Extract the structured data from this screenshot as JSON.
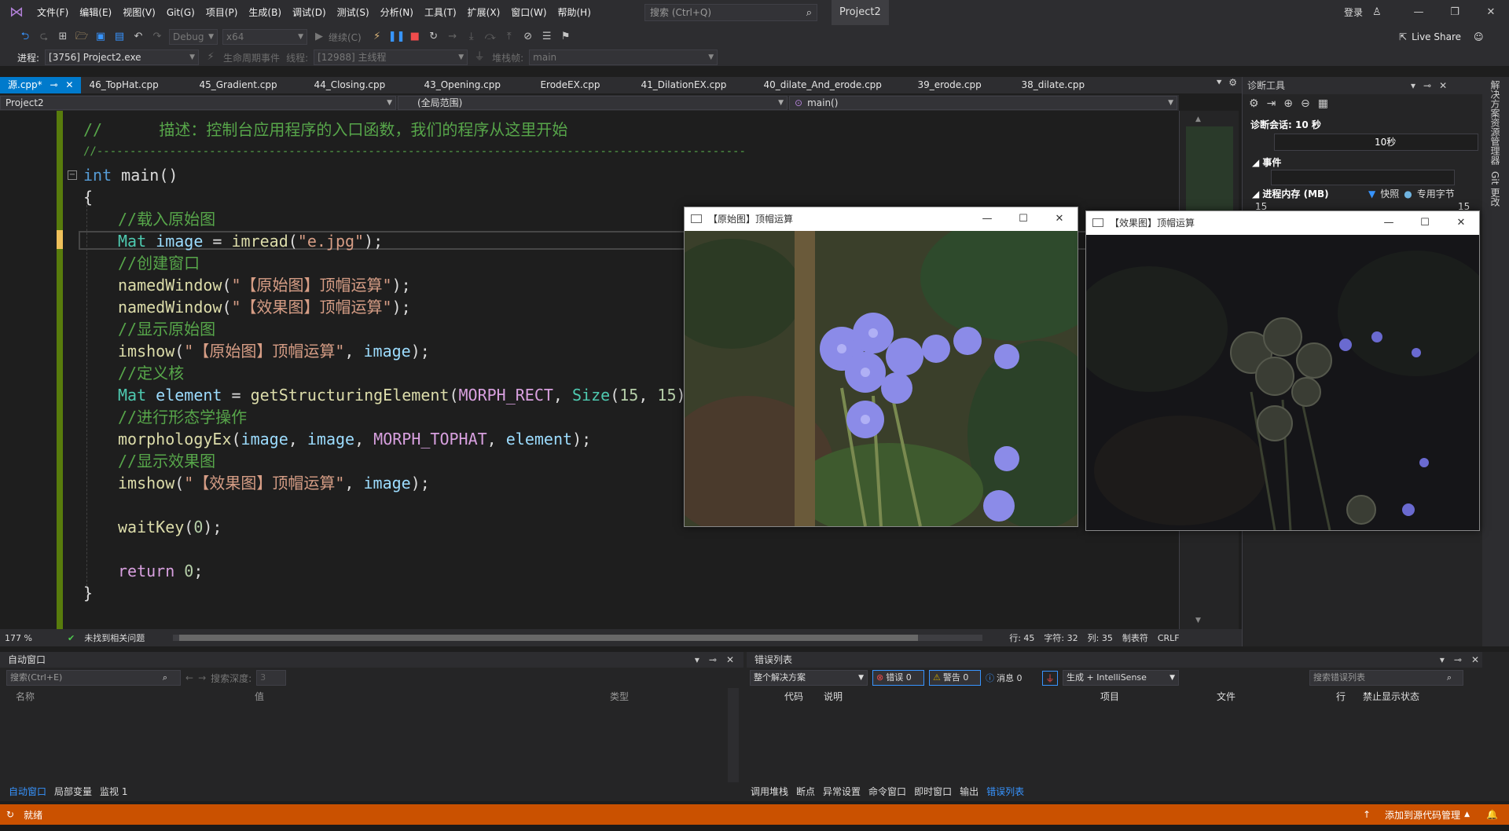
{
  "titlebar": {
    "menu": [
      "文件(F)",
      "编辑(E)",
      "视图(V)",
      "Git(G)",
      "项目(P)",
      "生成(B)",
      "调试(D)",
      "测试(S)",
      "分析(N)",
      "工具(T)",
      "扩展(X)",
      "窗口(W)",
      "帮助(H)"
    ],
    "search_placeholder": "搜索 (Ctrl+Q)",
    "project_name": "Project2",
    "signin": "登录"
  },
  "toolbar": {
    "config": "Debug",
    "platform": "x64",
    "continue": "继续(C)",
    "liveshare": "Live Share"
  },
  "toolbar2": {
    "process_label": "进程:",
    "process_value": "[3756] Project2.exe",
    "lifecycle": "生命周期事件",
    "thread_label": "线程:",
    "thread_value": "[12988] 主线程",
    "stack_label": "堆栈帧:",
    "stack_value": "main"
  },
  "tabs": [
    "源.cpp*",
    "46_TopHat.cpp",
    "45_Gradient.cpp",
    "44_Closing.cpp",
    "43_Opening.cpp",
    "ErodeEX.cpp",
    "41_DilationEX.cpp",
    "40_dilate_And_erode.cpp",
    "39_erode.cpp",
    "38_dilate.cpp"
  ],
  "navbar": {
    "project": "Project2",
    "scope": "(全局范围)",
    "function": "main()"
  },
  "code": {
    "l1": "//      描述：控制台应用程序的入口函数，我们的程序从这里开始",
    "l2": "//--------------------------------------------------------------------------------------------------",
    "l3_kw": "int",
    "l3_rest": " main()",
    "l4": "{",
    "l5": "//载入原始图",
    "l6_ty": "Mat",
    "l6_var": " image",
    "l6_eq": " = ",
    "l6_fn": "imread",
    "l6_open": "(",
    "l6_str": "\"e.jpg\"",
    "l6_close": ");",
    "l7": "//创建窗口",
    "l8_fn": "namedWindow",
    "l8_str": "\"【原始图】顶帽运算\"",
    "l9_fn": "namedWindow",
    "l9_str": "\"【效果图】顶帽运算\"",
    "l10": "//显示原始图",
    "l11_fn": "imshow",
    "l11_str": "\"【原始图】顶帽运算\"",
    "l11_var": "image",
    "l12": "//定义核",
    "l13_ty": "Mat",
    "l13_var": " element",
    "l13_fn": "getStructuringElement",
    "l13_mac": "MORPH_RECT",
    "l13_ty2": "Size",
    "l13_n1": "15",
    "l13_n2": "15",
    "l14": "//进行形态学操作",
    "l15_fn": "morphologyEx",
    "l15_args": "image",
    "l15_args2": "image",
    "l15_mac": "MORPH_TOPHAT",
    "l15_args3": "element",
    "l16": "//显示效果图",
    "l17_fn": "imshow",
    "l17_str": "\"【效果图】顶帽运算\"",
    "l17_var": "image",
    "l18_fn": "waitKey",
    "l18_n": "0",
    "l19_kw": "return",
    "l19_n": "0",
    "l20": "}"
  },
  "editor_status": {
    "zoom": "177 %",
    "issues": "未找到相关问题",
    "line": "行: 45",
    "char": "字符: 32",
    "col": "列: 35",
    "tabs": "制表符",
    "eol": "CRLF"
  },
  "diag": {
    "title": "诊断工具",
    "session": "诊断会话: 10 秒",
    "time": "10秒",
    "events": "事件",
    "memory": "进程内存 (MB)",
    "snapshot": "快照",
    "private_bytes": "专用字节",
    "mem_left": "15",
    "mem_right": "15"
  },
  "rail": {
    "solution": "解决方案资源管理器",
    "git": "Git 更改"
  },
  "windows": {
    "original": "【原始图】顶帽运算",
    "effect": "【效果图】顶帽运算"
  },
  "autos": {
    "title": "自动窗口",
    "search": "搜索(Ctrl+E)",
    "depth_label": "搜索深度:",
    "depth_value": "3",
    "col_name": "名称",
    "col_value": "值",
    "col_type": "类型",
    "tabs": [
      "自动窗口",
      "局部变量",
      "监视 1"
    ]
  },
  "errors": {
    "title": "错误列表",
    "scope": "整个解决方案",
    "errors": "错误 0",
    "warnings": "警告 0",
    "messages": "消息 0",
    "build": "生成 + IntelliSense",
    "search": "搜索错误列表",
    "cols": [
      "代码",
      "说明",
      "项目",
      "文件",
      "行",
      "禁止显示状态"
    ],
    "tabs": [
      "调用堆栈",
      "断点",
      "异常设置",
      "命令窗口",
      "即时窗口",
      "输出",
      "错误列表"
    ]
  },
  "statusbar": {
    "ready": "就绪",
    "source_control": "添加到源代码管理"
  },
  "colors": {
    "accent": "#007acc",
    "statusbar": "#ca5100",
    "comment": "#57a64a"
  }
}
